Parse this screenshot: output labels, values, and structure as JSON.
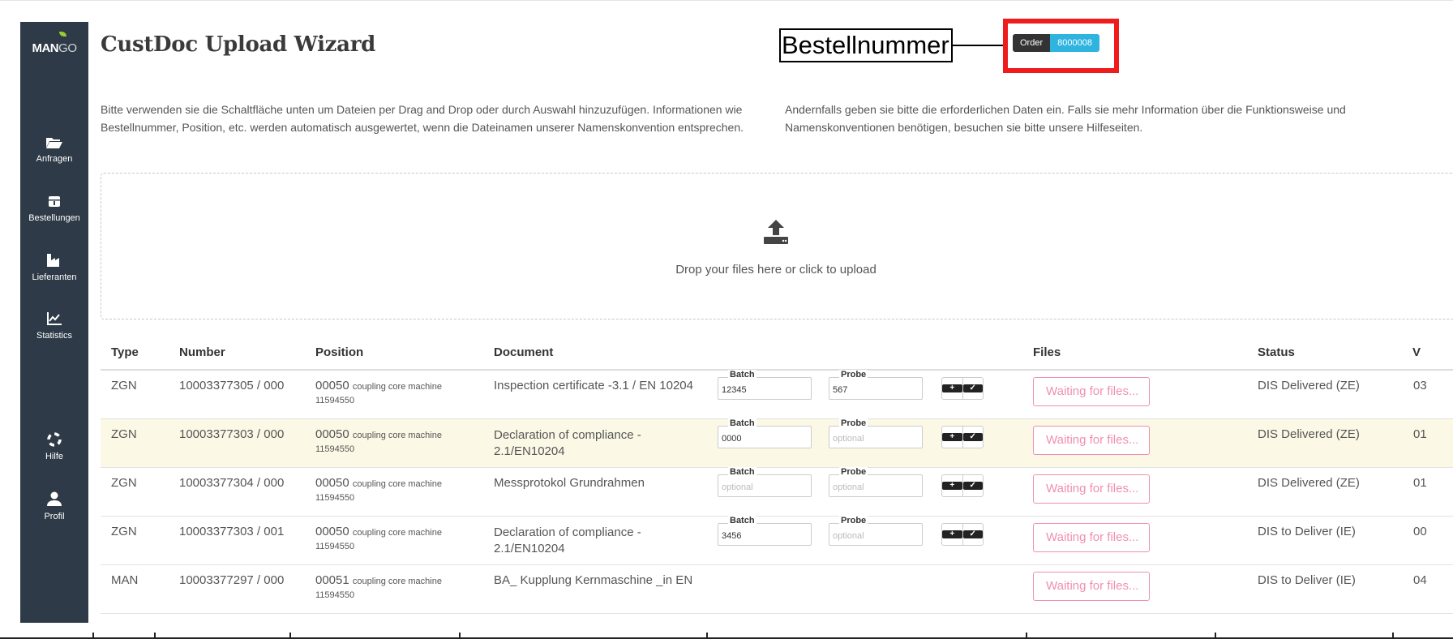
{
  "app": {
    "logo_text": "MANGO",
    "title": "CustDoc Upload Wizard"
  },
  "annotation": {
    "label": "Bestellnummer",
    "color": "#ee1c1c"
  },
  "order": {
    "key": "Order",
    "value": "8000008"
  },
  "sidebar": {
    "items": [
      {
        "label": "Anfragen",
        "icon": "folder-open-icon"
      },
      {
        "label": "Bestellungen",
        "icon": "package-icon"
      },
      {
        "label": "Lieferanten",
        "icon": "factory-icon"
      },
      {
        "label": "Statistics",
        "icon": "chart-line-icon"
      },
      {
        "label": "Hilfe",
        "icon": "life-ring-icon"
      },
      {
        "label": "Profil",
        "icon": "user-icon"
      }
    ]
  },
  "intro": {
    "left": "Bitte verwenden sie die Schaltfläche unten um Dateien per Drag and Drop oder durch Auswahl hinzuzufügen. Informationen wie Bestellnummer, Position, etc. werden automatisch ausgewertet, wenn die Dateinamen unserer Namenskonvention entsprechen.",
    "right": "Andernfalls geben sie bitte die erforderlichen Daten ein. Falls sie mehr Information über die Funktionsweise und Namenskonventionen benötigen, besuchen sie bitte unsere Hilfeseiten."
  },
  "dropzone": {
    "text": "Drop your files here or click to upload",
    "icon": "upload-icon"
  },
  "table": {
    "headers": {
      "type": "Type",
      "number": "Number",
      "position": "Position",
      "document": "Document",
      "files": "Files",
      "status": "Status",
      "v": "V"
    },
    "batch_label": "Batch",
    "probe_label": "Probe",
    "placeholder": "optional",
    "files_button": "Waiting for files...",
    "rows": [
      {
        "type": "ZGN",
        "number": "10003377305 / 000",
        "pos": "00050",
        "pos_desc": "coupling core machine",
        "pos_id": "11594550",
        "doc": "Inspection certificate -3.1 / EN 10204",
        "doc2": "",
        "batch": "12345",
        "probe": "567",
        "status": "DIS Delivered (ZE)",
        "v": "03"
      },
      {
        "type": "ZGN",
        "number": "10003377303 / 000",
        "pos": "00050",
        "pos_desc": "coupling core machine",
        "pos_id": "11594550",
        "doc": "Declaration of compliance -",
        "doc2": "2.1/EN10204",
        "batch": "0000",
        "probe": "",
        "status": "DIS Delivered (ZE)",
        "v": "01"
      },
      {
        "type": "ZGN",
        "number": "10003377304 / 000",
        "pos": "00050",
        "pos_desc": "coupling core machine",
        "pos_id": "11594550",
        "doc": "Messprotokol Grundrahmen",
        "doc2": "",
        "batch": "",
        "probe": "",
        "status": "DIS Delivered (ZE)",
        "v": "01"
      },
      {
        "type": "ZGN",
        "number": "10003377303 / 001",
        "pos": "00050",
        "pos_desc": "coupling core machine",
        "pos_id": "11594550",
        "doc": "Declaration of compliance -",
        "doc2": "2.1/EN10204",
        "batch": "3456",
        "probe": "",
        "status": "DIS to Deliver (IE)",
        "v": "00"
      },
      {
        "type": "MAN",
        "number": "10003377297 / 000",
        "pos": "00051",
        "pos_desc": "coupling core machine",
        "pos_id": "11594550",
        "doc": "BA_ Kupplung Kernmaschine _in EN",
        "doc2": "",
        "batch": null,
        "probe": null,
        "status": "DIS to Deliver (IE)",
        "v": "04"
      }
    ]
  }
}
